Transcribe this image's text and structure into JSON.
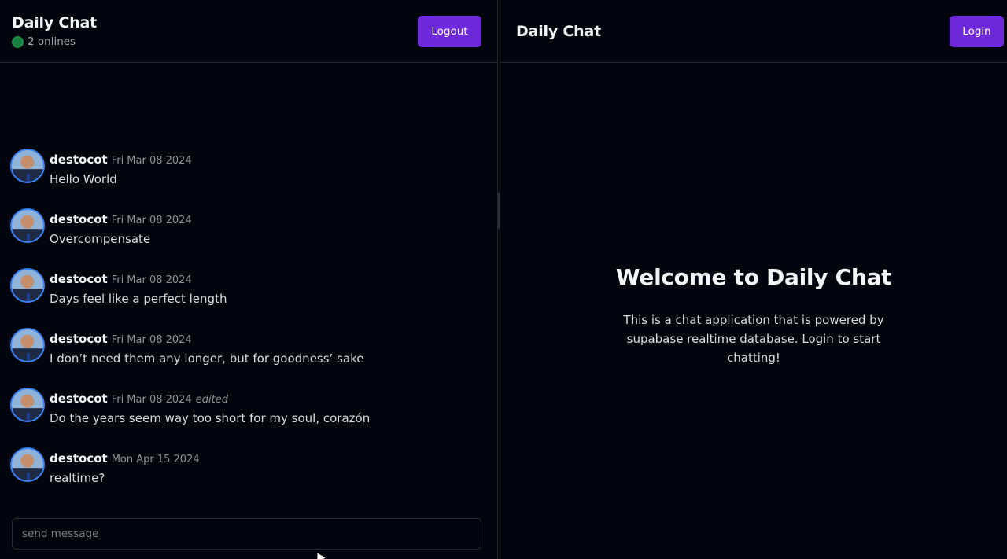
{
  "left_panel": {
    "header": {
      "title": "Daily Chat",
      "online_text": "2 onlines",
      "logout_label": "Logout"
    },
    "messages": [
      {
        "user": "destocot",
        "date": "Fri Mar 08 2024",
        "edited": "",
        "text": "Hello World"
      },
      {
        "user": "destocot",
        "date": "Fri Mar 08 2024",
        "edited": "",
        "text": "Overcompensate"
      },
      {
        "user": "destocot",
        "date": "Fri Mar 08 2024",
        "edited": "",
        "text": "Days feel like a perfect length"
      },
      {
        "user": "destocot",
        "date": "Fri Mar 08 2024",
        "edited": "",
        "text": "I don’t need them any longer, but for goodness’ sake"
      },
      {
        "user": "destocot",
        "date": "Fri Mar 08 2024",
        "edited": "edited",
        "text": "Do the years seem way too short for my soul, corazón"
      },
      {
        "user": "destocot",
        "date": "Mon Apr 15 2024",
        "edited": "",
        "text": "realtime?"
      }
    ],
    "composer": {
      "placeholder": "send message",
      "value": ""
    }
  },
  "right_panel": {
    "header": {
      "title": "Daily Chat",
      "login_label": "Login"
    },
    "welcome": {
      "title": "Welcome to Daily Chat",
      "text": "This is a chat application that is powered by supabase realtime database. Login to start chatting!"
    }
  },
  "colors": {
    "background": "#02050e",
    "accent": "#6d28d9",
    "online": "#15803d",
    "avatar_ring": "#3b82f6"
  },
  "icons": {
    "online_indicator": "online-dot-icon",
    "avatar": "avatar-icon",
    "cursor": "mouse-cursor-icon"
  }
}
